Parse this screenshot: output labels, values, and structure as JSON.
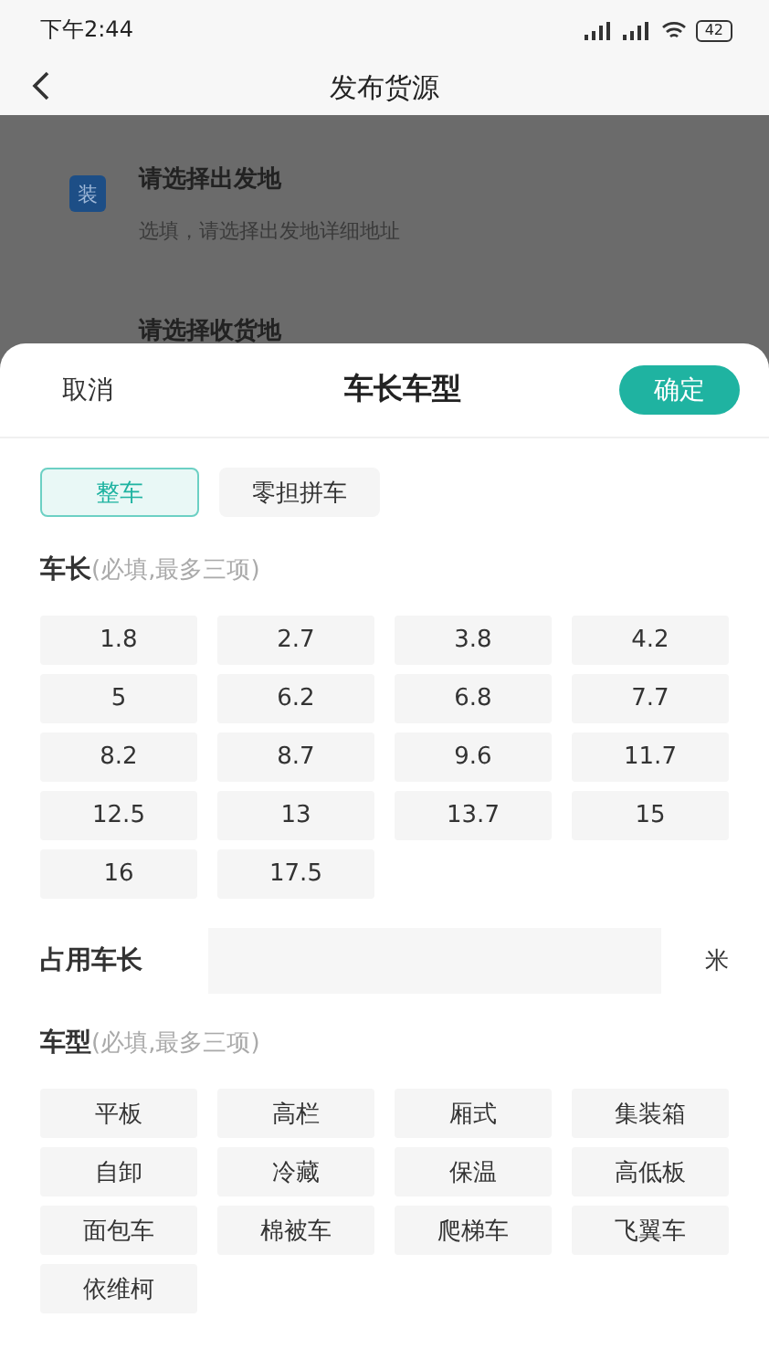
{
  "status_bar": {
    "time": "下午2:44",
    "battery": "42"
  },
  "nav": {
    "title": "发布货源"
  },
  "background_form": {
    "badge": "装",
    "origin_title": "请选择出发地",
    "origin_hint": "选填，请选择出发地详细地址",
    "destination_title": "请选择收货地"
  },
  "sheet": {
    "cancel": "取消",
    "title": "车长车型",
    "confirm": "确定",
    "modes": [
      {
        "label": "整车",
        "selected": true
      },
      {
        "label": "零担拼车",
        "selected": false
      }
    ],
    "length_section": {
      "title": "车长",
      "note": "(必填,最多三项)"
    },
    "lengths": [
      {
        "label": "1.8",
        "selected": false
      },
      {
        "label": "2.7",
        "selected": false
      },
      {
        "label": "3.8",
        "selected": false
      },
      {
        "label": "4.2",
        "selected": false
      },
      {
        "label": "5",
        "selected": false
      },
      {
        "label": "6.2",
        "selected": false
      },
      {
        "label": "6.8",
        "selected": false
      },
      {
        "label": "7.7",
        "selected": false
      },
      {
        "label": "8.2",
        "selected": false
      },
      {
        "label": "8.7",
        "selected": false
      },
      {
        "label": "9.6",
        "selected": false
      },
      {
        "label": "11.7",
        "selected": false
      },
      {
        "label": "12.5",
        "selected": false
      },
      {
        "label": "13",
        "selected": false
      },
      {
        "label": "13.7",
        "selected": false
      },
      {
        "label": "15",
        "selected": false
      },
      {
        "label": "16",
        "selected": false
      },
      {
        "label": "17.5",
        "selected": false
      }
    ],
    "occupied_length": {
      "label": "占用车长",
      "unit": "米"
    },
    "type_section": {
      "title": "车型",
      "note": "(必填,最多三项)"
    },
    "types": [
      {
        "label": "平板",
        "selected": false
      },
      {
        "label": "高栏",
        "selected": false
      },
      {
        "label": "厢式",
        "selected": false
      },
      {
        "label": "集装箱",
        "selected": false
      },
      {
        "label": "自卸",
        "selected": false
      },
      {
        "label": "冷藏",
        "selected": false
      },
      {
        "label": "保温",
        "selected": false
      },
      {
        "label": "高低板",
        "selected": false
      },
      {
        "label": "面包车",
        "selected": false
      },
      {
        "label": "棉被车",
        "selected": false
      },
      {
        "label": "爬梯车",
        "selected": false
      },
      {
        "label": "飞翼车",
        "selected": false
      },
      {
        "label": "依维柯",
        "selected": false
      }
    ]
  }
}
